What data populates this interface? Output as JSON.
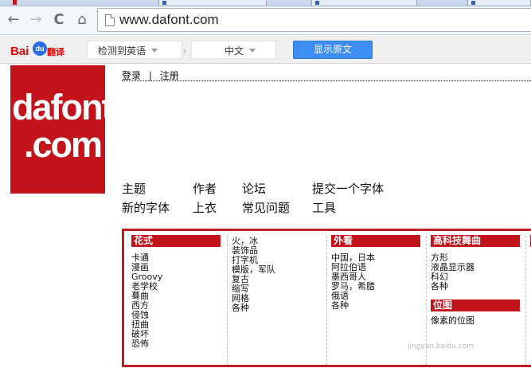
{
  "browser": {
    "url": "www.dafont.com",
    "back_glyph": "←",
    "forward_glyph": "→",
    "reload_glyph": "C",
    "home_glyph": "⌂"
  },
  "translate_bar": {
    "logo_red": "Bai",
    "logo_paw": "du",
    "logo_trans": "翻译",
    "detect_label": "检测到英语",
    "target_lang": "中文",
    "chevron": "›",
    "show_original_label": "显示原文"
  },
  "site": {
    "logo_line1": "dafont",
    "logo_line2": ".com",
    "login": "登录",
    "separator": "|",
    "register": "注册",
    "nav": [
      {
        "label": "主题"
      },
      {
        "label": "作者"
      },
      {
        "label": "论坛"
      },
      {
        "label": "提交一个字体"
      },
      {
        "label": "新的字体"
      },
      {
        "label": "上衣"
      },
      {
        "label": "常见问题"
      },
      {
        "label": "工具"
      }
    ]
  },
  "categories": [
    {
      "head": "花式",
      "items": [
        "卡通",
        "漫画",
        "Groovy",
        "老学校",
        "蓦曲",
        "西方",
        "侵蚀",
        "扭曲",
        "破坏",
        "恐怖"
      ]
    },
    {
      "head": "",
      "items": [
        "火，冰",
        "装饰品",
        "打字机",
        "模版，军队",
        "复古",
        "缩写",
        "网格",
        "各种"
      ]
    },
    {
      "head": "外看",
      "items": [
        "中国，日本",
        "阿拉伯语",
        "墨西哥人",
        "罗马，希腊",
        "俄语",
        "各种"
      ]
    },
    {
      "head": "高科技舞曲",
      "items": [
        "方形",
        "液晶显示器",
        "科幻",
        "各种"
      ],
      "head2": "位图",
      "items2": [
        "像素的位图"
      ]
    }
  ],
  "watermark": "jingyan.baidu.com",
  "colors": {
    "brand_red": "#c4141b",
    "translate_blue": "#3e8df0"
  }
}
